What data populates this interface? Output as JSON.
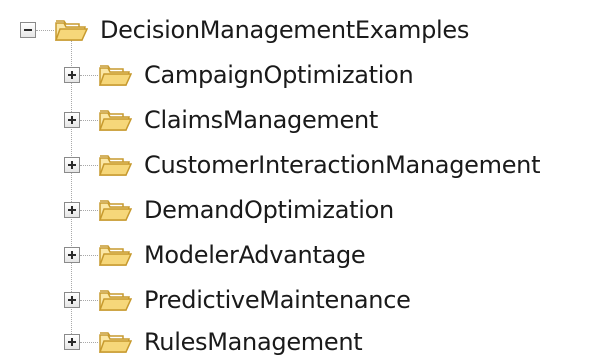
{
  "tree": {
    "root": {
      "label": "DecisionManagementExamples",
      "expanded": true,
      "icon": "folder-open-icon"
    },
    "children": [
      {
        "label": "CampaignOptimization",
        "expanded": false,
        "icon": "folder-open-icon"
      },
      {
        "label": "ClaimsManagement",
        "expanded": false,
        "icon": "folder-open-icon"
      },
      {
        "label": "CustomerInteractionManagement",
        "expanded": false,
        "icon": "folder-open-icon"
      },
      {
        "label": "DemandOptimization",
        "expanded": false,
        "icon": "folder-open-icon"
      },
      {
        "label": "ModelerAdvantage",
        "expanded": false,
        "icon": "folder-open-icon"
      },
      {
        "label": "PredictiveMaintenance",
        "expanded": false,
        "icon": "folder-open-icon"
      },
      {
        "label": "RulesManagement",
        "expanded": false,
        "icon": "folder-open-icon"
      }
    ],
    "colors": {
      "folder_fill": "#f6d77a",
      "folder_stroke": "#c79a2e",
      "text": "#1a1a1a",
      "connector": "#a9a9a9"
    }
  }
}
